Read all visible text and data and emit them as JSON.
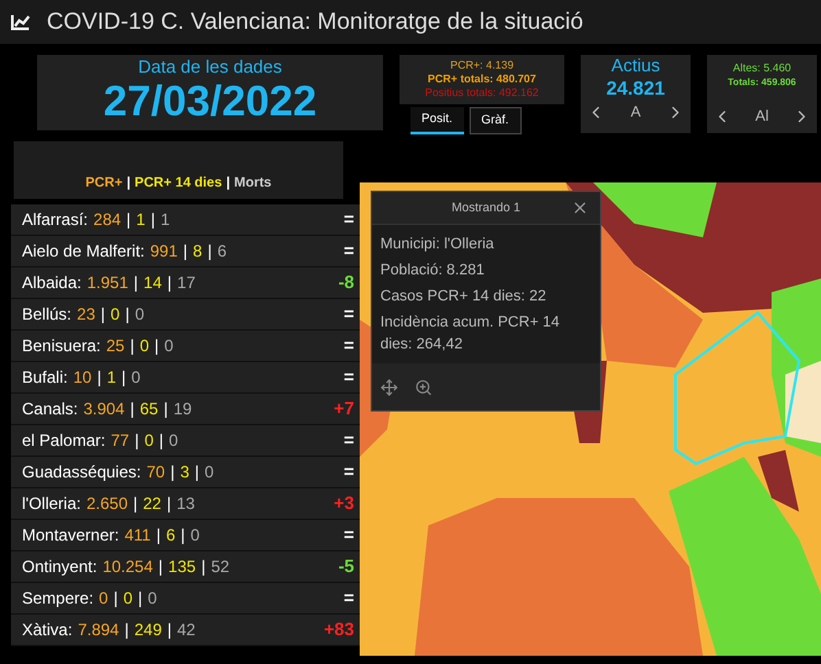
{
  "window": {
    "title": "COVID-19 C. Valenciana: Monitoratge de la situació"
  },
  "date_panel": {
    "label": "Data de les dades",
    "value": "27/03/2022"
  },
  "positives_panel": {
    "pcr": "PCR+: 4.139",
    "pcr_total": "PCR+ totals: 480.707",
    "positive_total": "Positius totals: 492.162"
  },
  "tabs": [
    {
      "label": "Posit.",
      "selected": true
    },
    {
      "label": "Gràf.",
      "selected": false
    }
  ],
  "active_panel": {
    "label": "Actius",
    "value": "24.821",
    "pager_text": "A"
  },
  "discharges_panel": {
    "altes": "Altes: 5.460",
    "total": "Totals: 459.806",
    "pager_text": "Al"
  },
  "legend": {
    "pcr": "PCR+",
    "pcr14": "PCR+ 14 dies",
    "deaths": "Morts",
    "separators": [
      "|",
      "|"
    ]
  },
  "municipalities": [
    {
      "name": "Alfarrasí:",
      "pcr": "284",
      "pcr14": "1",
      "deaths": "1",
      "separators": [
        "|",
        "|"
      ],
      "change": "=",
      "color": "#ffffff"
    },
    {
      "name": "Aielo de Malferit:",
      "pcr": "991",
      "pcr14": "8",
      "deaths": "6",
      "separators": [
        "|",
        "|"
      ],
      "change": "=",
      "color": "#ffffff"
    },
    {
      "name": "Albaida:",
      "pcr": "1.951",
      "pcr14": "14",
      "deaths": "17",
      "separators": [
        "|",
        "|"
      ],
      "change": "-8",
      "color": "#6cdb3a"
    },
    {
      "name": "Bellús:",
      "pcr": "23",
      "pcr14": "0",
      "deaths": "0",
      "separators": [
        "|",
        "|"
      ],
      "change": "=",
      "color": "#ffffff"
    },
    {
      "name": "Benisuera:",
      "pcr": "25",
      "pcr14": "0",
      "deaths": "0",
      "separators": [
        "|",
        "|"
      ],
      "change": "=",
      "color": "#ffffff"
    },
    {
      "name": "Bufali:",
      "pcr": "10",
      "pcr14": "1",
      "deaths": "0",
      "separators": [
        "|",
        "|"
      ],
      "change": "=",
      "color": "#ffffff"
    },
    {
      "name": "Canals:",
      "pcr": "3.904",
      "pcr14": "65",
      "deaths": "19",
      "separators": [
        "|",
        "|"
      ],
      "change": "+7",
      "color": "#ff2020"
    },
    {
      "name": "el Palomar:",
      "pcr": "77",
      "pcr14": "0",
      "deaths": "0",
      "separators": [
        "|",
        "|"
      ],
      "change": "=",
      "color": "#ffffff"
    },
    {
      "name": "Guadasséquies:",
      "pcr": "70",
      "pcr14": "3",
      "deaths": "0",
      "separators": [
        "|",
        "|"
      ],
      "change": "=",
      "color": "#ffffff"
    },
    {
      "name": "l'Olleria:",
      "pcr": "2.650",
      "pcr14": "22",
      "deaths": "13",
      "separators": [
        "|",
        "|"
      ],
      "change": "+3",
      "color": "#ff2020"
    },
    {
      "name": "Montaverner:",
      "pcr": "411",
      "pcr14": "6",
      "deaths": "0",
      "separators": [
        "|",
        "|"
      ],
      "change": "=",
      "color": "#ffffff"
    },
    {
      "name": "Ontinyent:",
      "pcr": "10.254",
      "pcr14": "135",
      "deaths": "52",
      "separators": [
        "|",
        "|"
      ],
      "change": "-5",
      "color": "#6cdb3a"
    },
    {
      "name": "Sempere:",
      "pcr": "0",
      "pcr14": "0",
      "deaths": "0",
      "separators": [
        "|",
        "|"
      ],
      "change": "=",
      "color": "#ffffff"
    },
    {
      "name": "Xàtiva:",
      "pcr": "7.894",
      "pcr14": "249",
      "deaths": "42",
      "separators": [
        "|",
        "|"
      ],
      "change": "+83",
      "color": "#ff2020"
    }
  ],
  "map": {
    "kind": "picture",
    "popup": {
      "title": "Mostrando 1",
      "lines": [
        "Municipi: l'Olleria",
        "Població: 8.281",
        "Casos PCR+ 14 dies: 22",
        "Incidència acum. PCR+ 14 dies: 264,42"
      ]
    }
  }
}
